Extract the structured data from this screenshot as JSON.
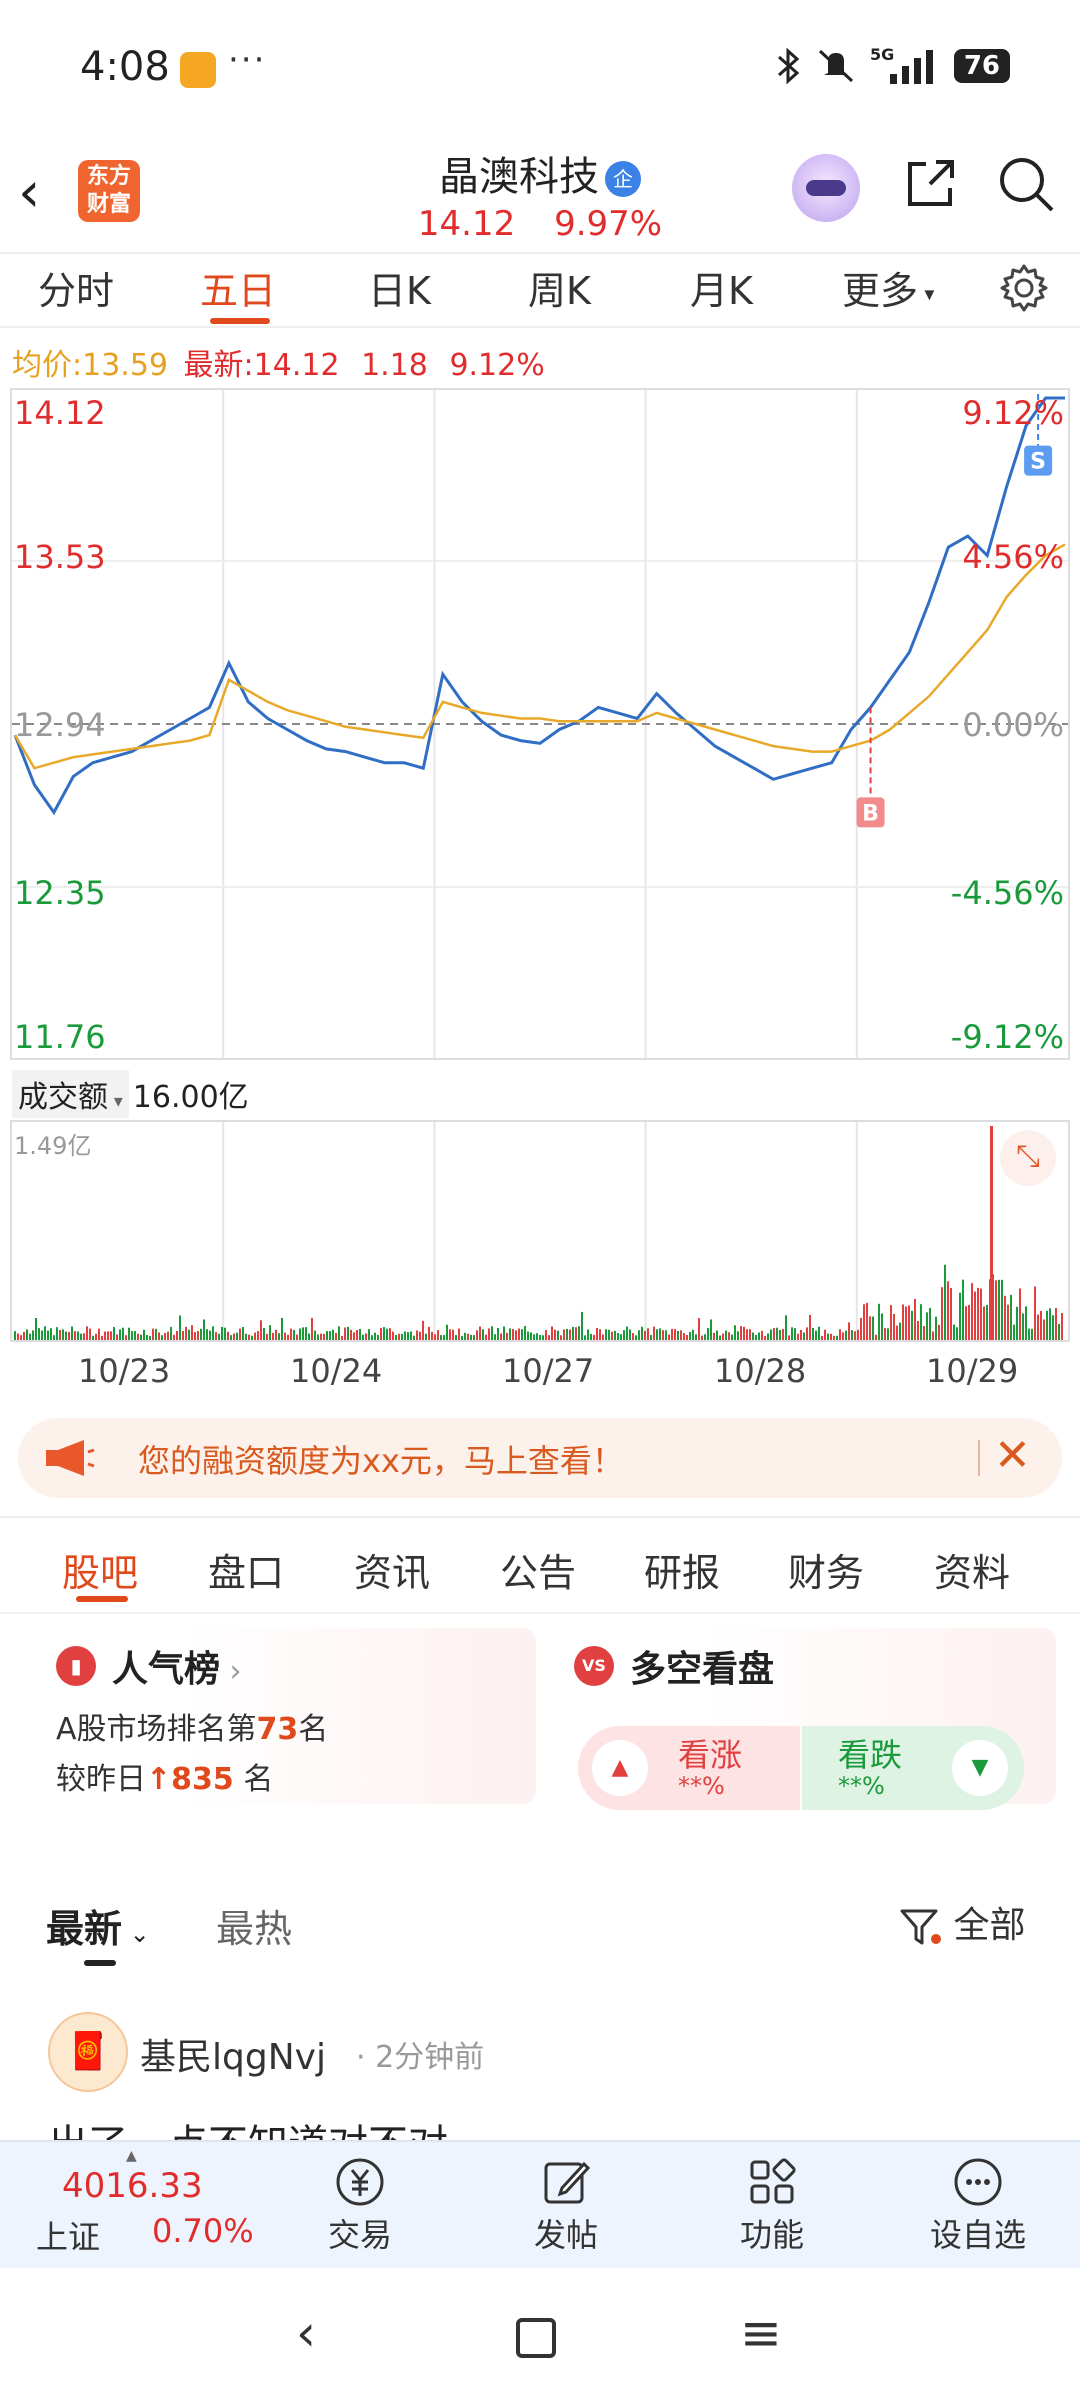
{
  "status_bar": {
    "time": "4:08",
    "dots": "···",
    "network": "5G",
    "battery": "76"
  },
  "header": {
    "stock_name": "晶澳科技",
    "badge": "企",
    "price": "14.12",
    "change_pct": "9.97%",
    "logo": "东方\n财富"
  },
  "tabs": [
    "分时",
    "五日",
    "日K",
    "周K",
    "月K",
    "更多"
  ],
  "active_tab": "五日",
  "info": {
    "avg_label": "均价:",
    "avg": "13.59",
    "latest_label": "最新:",
    "latest": "14.12",
    "change": "1.18",
    "pct": "9.12%"
  },
  "chart_data": {
    "type": "line",
    "title": "",
    "y_left_ticks": [
      "14.12",
      "13.53",
      "12.94",
      "12.35",
      "11.76"
    ],
    "y_right_ticks": [
      "9.12%",
      "4.56%",
      "0.00%",
      "-4.56%",
      "-9.12%"
    ],
    "ylim": [
      11.76,
      14.12
    ],
    "baseline": 12.94,
    "x_dates": [
      "10/23",
      "10/24",
      "10/27",
      "10/28",
      "10/29"
    ],
    "markers": [
      {
        "label": "B",
        "day": "10/28"
      },
      {
        "label": "S",
        "day": "10/29"
      }
    ],
    "series": [
      {
        "color": "#2f6ec4",
        "values": [
          12.9,
          12.72,
          12.62,
          12.75,
          12.8,
          12.82,
          12.84,
          12.88,
          12.92,
          12.96,
          13.0,
          13.16,
          13.02,
          12.96,
          12.92,
          12.88,
          12.85,
          12.84,
          12.82,
          12.8,
          12.8,
          12.78,
          13.12,
          13.02,
          12.95,
          12.9,
          12.88,
          12.87,
          12.92,
          12.95,
          13.0,
          12.98,
          12.96,
          13.05,
          12.98,
          12.92,
          12.86,
          12.82,
          12.78,
          12.74,
          12.76,
          12.78,
          12.8,
          12.92,
          13.0,
          13.1,
          13.2,
          13.38,
          13.58,
          13.62,
          13.55,
          13.8,
          14.02,
          14.12,
          14.12
        ]
      },
      {
        "color": "#e8a92a",
        "values": [
          12.9,
          12.78,
          12.8,
          12.82,
          12.83,
          12.84,
          12.85,
          12.86,
          12.87,
          12.88,
          12.9,
          13.1,
          13.06,
          13.02,
          12.99,
          12.97,
          12.95,
          12.93,
          12.92,
          12.91,
          12.9,
          12.89,
          13.02,
          13.0,
          12.98,
          12.97,
          12.96,
          12.96,
          12.95,
          12.95,
          12.95,
          12.95,
          12.95,
          12.98,
          12.96,
          12.94,
          12.92,
          12.9,
          12.88,
          12.86,
          12.85,
          12.84,
          12.84,
          12.86,
          12.88,
          12.92,
          12.98,
          13.04,
          13.12,
          13.2,
          13.28,
          13.4,
          13.48,
          13.55,
          13.59
        ]
      }
    ],
    "volume": {
      "label": "成交额",
      "total": "16.00亿",
      "max": "1.49亿"
    }
  },
  "banner": {
    "text": "您的融资额度为xx元，马上查看！"
  },
  "subtabs": [
    "股吧",
    "盘口",
    "资讯",
    "公告",
    "研报",
    "财务",
    "资料"
  ],
  "active_subtab": "股吧",
  "card_popular": {
    "title": "人气榜",
    "line1_prefix": "A股市场排名第",
    "rank": "73",
    "line1_suffix": "名",
    "line2_prefix": "较昨日",
    "delta": "835",
    "line2_suffix": "名"
  },
  "card_vs": {
    "title": "多空看盘",
    "icon": "VS",
    "rise": "看涨",
    "rise_pct": "**%",
    "fall": "看跌",
    "fall_pct": "**%"
  },
  "feed": {
    "tab_latest": "最新",
    "tab_hot": "最热",
    "filter": "全部"
  },
  "post": {
    "user": "基民lqgNvj",
    "time": "2分钟前",
    "preview": "出了一点不知道对不对"
  },
  "bottom": {
    "index_value": "4016.33",
    "index_name": "上证",
    "index_pct": "0.70%",
    "items": [
      "交易",
      "发帖",
      "功能",
      "设自选"
    ]
  },
  "colors": {
    "accent": "#e0491b",
    "up": "#e02c2c",
    "down": "#1a9a3a",
    "avg_line": "#e8a92a",
    "price_line": "#2f6ec4"
  }
}
